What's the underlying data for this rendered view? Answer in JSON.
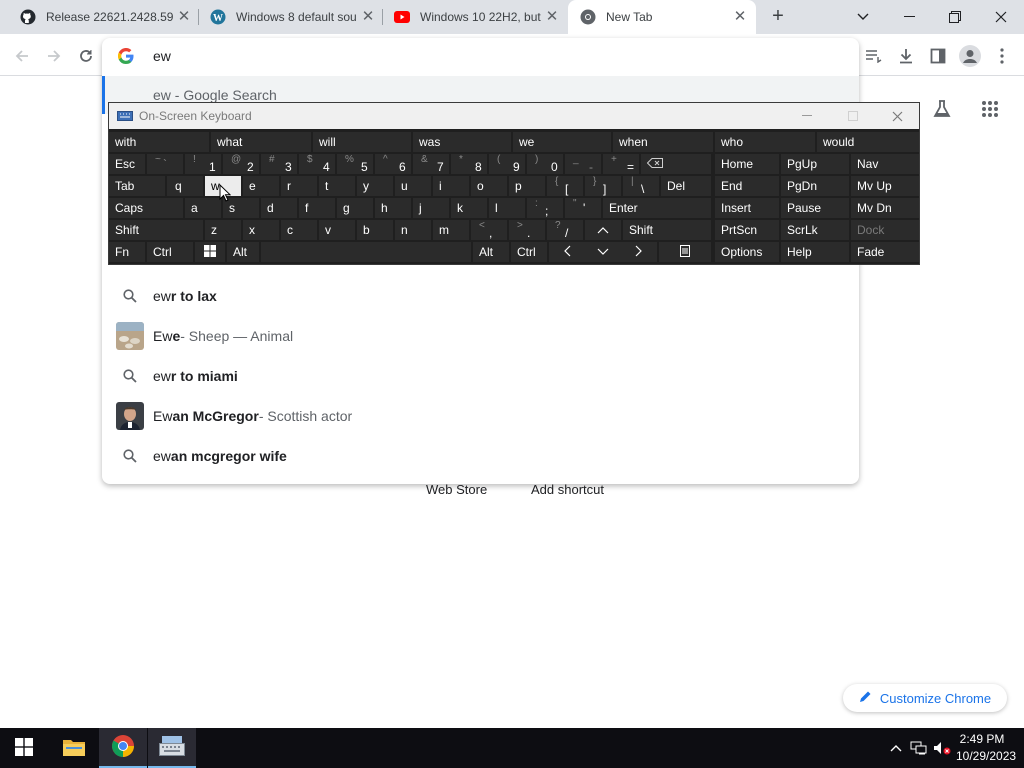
{
  "browser": {
    "tabs": [
      {
        "title": "Release 22621.2428.59",
        "icon": "github-icon",
        "active": false
      },
      {
        "title": "Windows 8 default sou",
        "icon": "wordpress-icon",
        "active": false
      },
      {
        "title": "Windows 10 22H2, but",
        "icon": "youtube-icon",
        "active": false
      },
      {
        "title": "New Tab",
        "icon": "chrome-icon",
        "active": true
      }
    ],
    "new_tab_glyph": "+",
    "close_glyph": "✕"
  },
  "omnibox": {
    "value": "ew",
    "top_suggestion": "ew - Google Search",
    "suggestions": [
      {
        "type": "search",
        "prefix": "ew",
        "bold": "r to lax",
        "suffix": ""
      },
      {
        "type": "entity",
        "prefix": "Ew",
        "bold": "e",
        "suffix": " - Sheep — Animal"
      },
      {
        "type": "search",
        "prefix": "ew",
        "bold": "r to miami",
        "suffix": ""
      },
      {
        "type": "entity",
        "prefix": "Ew",
        "bold": "an McGregor",
        "suffix": " - Scottish actor"
      },
      {
        "type": "search",
        "prefix": "ew",
        "bold": "an mcgregor wife",
        "suffix": ""
      }
    ]
  },
  "ntp": {
    "web_store": "Web Store",
    "add_shortcut": "Add shortcut",
    "customize": "Customize Chrome"
  },
  "osk": {
    "title": "On-Screen Keyboard",
    "predictions": [
      "with",
      "what",
      "will",
      "was",
      "we",
      "when",
      "who",
      "would"
    ],
    "row1": [
      {
        "label": "Esc"
      },
      {
        "shift": "~",
        "main": "`"
      },
      {
        "shift": "!",
        "main": "1"
      },
      {
        "shift": "@",
        "main": "2"
      },
      {
        "shift": "#",
        "main": "3"
      },
      {
        "shift": "$",
        "main": "4"
      },
      {
        "shift": "%",
        "main": "5"
      },
      {
        "shift": "^",
        "main": "6"
      },
      {
        "shift": "&",
        "main": "7"
      },
      {
        "shift": "*",
        "main": "8"
      },
      {
        "shift": "(",
        "main": "9"
      },
      {
        "shift": ")",
        "main": "0"
      },
      {
        "shift": "_",
        "main": "-"
      },
      {
        "shift": "+",
        "main": "="
      },
      {
        "label": "⌫"
      }
    ],
    "row2": [
      "Tab",
      "q",
      "w",
      "e",
      "r",
      "t",
      "y",
      "u",
      "i",
      "o",
      "p",
      "[",
      "]",
      "\\",
      "Del"
    ],
    "row2_shift": {
      "[": "{",
      "]": "}",
      "\\": "|"
    },
    "row3": [
      "Caps",
      "a",
      "s",
      "d",
      "f",
      "g",
      "h",
      "j",
      "k",
      "l",
      ";",
      "'",
      "Enter"
    ],
    "row3_shift": {
      ";": ":",
      "'": "\""
    },
    "row4": [
      "Shift",
      "z",
      "x",
      "c",
      "v",
      "b",
      "n",
      "m",
      ",",
      ".",
      "/",
      "^",
      "Shift"
    ],
    "row4_shift": {
      ",": "<",
      ".": ">",
      "/": "?"
    },
    "row5": [
      "Fn",
      "Ctrl",
      "⊞",
      "Alt",
      "",
      "Alt",
      "Ctrl",
      "<",
      "∨",
      ">",
      "▤"
    ],
    "nav": [
      [
        "Home",
        "PgUp",
        "Nav"
      ],
      [
        "End",
        "PgDn",
        "Mv Up"
      ],
      [
        "Insert",
        "Pause",
        "Mv Dn"
      ],
      [
        "PrtScn",
        "ScrLk",
        "Dock"
      ],
      [
        "Options",
        "Help",
        "Fade"
      ]
    ]
  },
  "taskbar": {
    "time": "2:49 PM",
    "date": "10/29/2023"
  },
  "colors": {
    "accent": "#1a73e8",
    "tabstrip": "#dee1e6",
    "osk_bg": "#1f1f1f",
    "osk_key": "#2b2b2b",
    "taskbar": "#0d0d12"
  }
}
